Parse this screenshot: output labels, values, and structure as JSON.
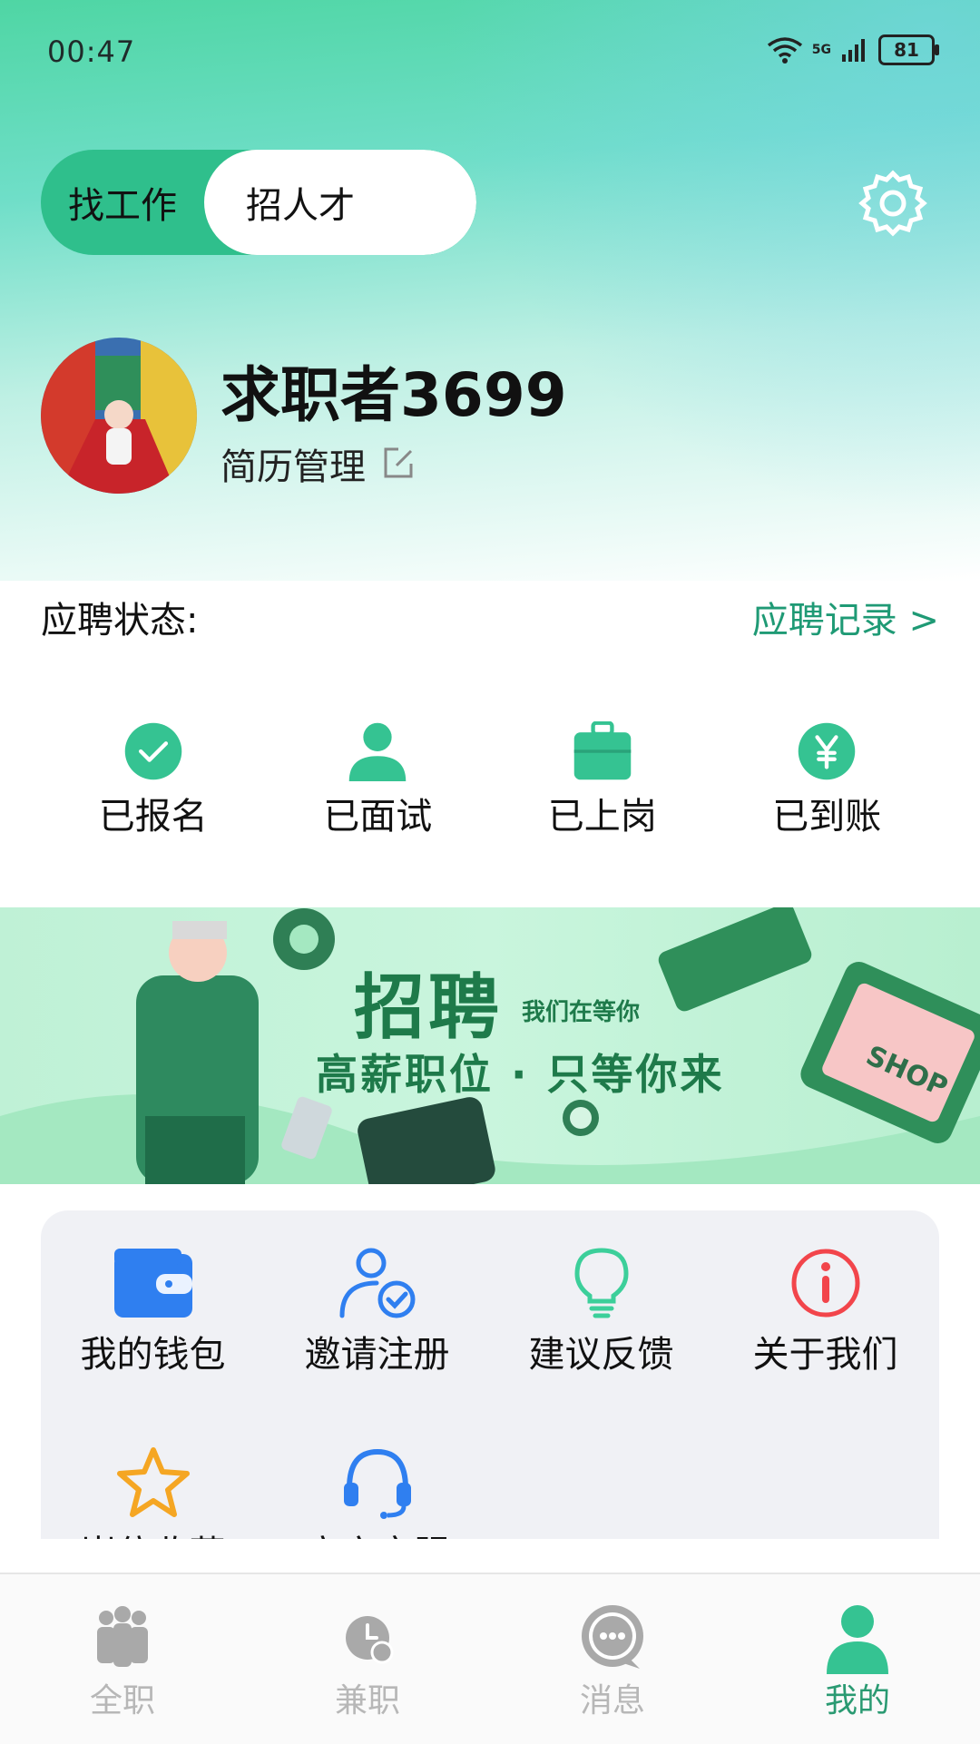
{
  "status_bar": {
    "time": "00:47",
    "battery": "81",
    "network": "5G"
  },
  "role_toggle": {
    "find_job": "找工作",
    "hire_talent": "招人才"
  },
  "profile": {
    "name": "求职者3699",
    "resume_label": "简历管理"
  },
  "application": {
    "label": "应聘状态:",
    "records_link": "应聘记录 >"
  },
  "status_items": [
    {
      "label": "已报名",
      "icon": "check-circle-icon"
    },
    {
      "label": "已面试",
      "icon": "person-icon"
    },
    {
      "label": "已上岗",
      "icon": "briefcase-icon"
    },
    {
      "label": "已到账",
      "icon": "yen-icon"
    }
  ],
  "banner": {
    "title": "招聘",
    "sub1": "我们在等你",
    "sub2": "高薪职位 · 只等你来",
    "shop": "SHOP"
  },
  "menu_items": [
    {
      "label": "我的钱包",
      "icon": "wallet-icon"
    },
    {
      "label": "邀请注册",
      "icon": "invite-user-icon"
    },
    {
      "label": "建议反馈",
      "icon": "lightbulb-icon"
    },
    {
      "label": "关于我们",
      "icon": "info-icon"
    },
    {
      "label": "岗位收藏",
      "icon": "star-icon"
    },
    {
      "label": "官方客服",
      "icon": "headset-icon"
    }
  ],
  "bottom_nav": [
    {
      "label": "全职",
      "icon": "group-icon"
    },
    {
      "label": "兼职",
      "icon": "clock-yen-icon"
    },
    {
      "label": "消息",
      "icon": "chat-icon"
    },
    {
      "label": "我的",
      "icon": "user-icon",
      "active": true
    }
  ],
  "colors": {
    "accent": "#2fbf8c",
    "link": "#1f9a75",
    "nav_active": "#2a9a72"
  }
}
